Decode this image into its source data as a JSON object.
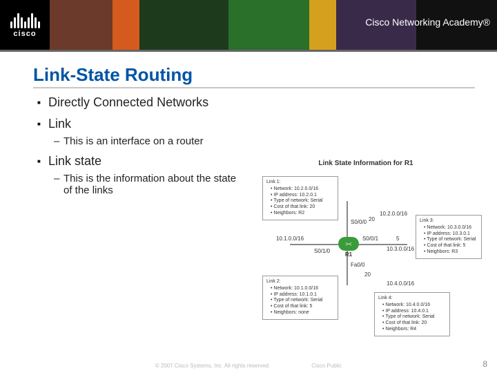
{
  "header": {
    "brand_name": "cisco",
    "academy_label": "Cisco Networking Academy®"
  },
  "slide": {
    "title": "Link-State Routing",
    "bullets": [
      {
        "level": 1,
        "text": "Directly Connected Networks"
      },
      {
        "level": 1,
        "text": "Link"
      },
      {
        "level": 2,
        "text": "This is an interface on a router"
      },
      {
        "level": 1,
        "text": "Link state"
      },
      {
        "level": 2,
        "text": "This is the information about the state of the links"
      }
    ]
  },
  "diagram": {
    "title": "Link State Information for R1",
    "router_label": "R1",
    "net_labels": {
      "n1": "10.1.0.0/16",
      "n2": "10.2.0.0/16",
      "n3": "10.3.0.0/16",
      "n4": "10.4.0.0/16"
    },
    "iface_labels": {
      "s010": "S0/1/0",
      "s000": "S0/0/0",
      "s001": "S0/0/1",
      "fa00": "Fa0/0"
    },
    "costs": {
      "c5": "5",
      "c20a": "20",
      "c20b": "20"
    },
    "link1": {
      "hd": "Link 1:",
      "items": [
        "Network: 10.2.0.0/16",
        "IP address: 10.2.0.1",
        "Type of network: Serial",
        "Cost of that link: 20",
        "Neighbors: R2"
      ]
    },
    "link2": {
      "hd": "Link 2:",
      "items": [
        "Network: 10.1.0.0/16",
        "IP address: 10.1.0.1",
        "Type of network: Serial",
        "Cost of that link: 5",
        "Neighbors: none"
      ]
    },
    "link3": {
      "hd": "Link 3:",
      "items": [
        "Network: 10.3.0.0/16",
        "IP address: 10.3.0.1",
        "Type of network: Serial",
        "Cost of that link: 5",
        "Neighbors: R3"
      ]
    },
    "link4": {
      "hd": "Link 4:",
      "items": [
        "Network: 10.4.0.0/16",
        "IP address: 10.4.0.1",
        "Type of network: Serial",
        "Cost of that link: 20",
        "Neighbors: R4"
      ]
    }
  },
  "footer": {
    "copyright": "© 2007 Cisco Systems, Inc. All rights reserved.",
    "audience": "Cisco Public",
    "page": "8"
  }
}
